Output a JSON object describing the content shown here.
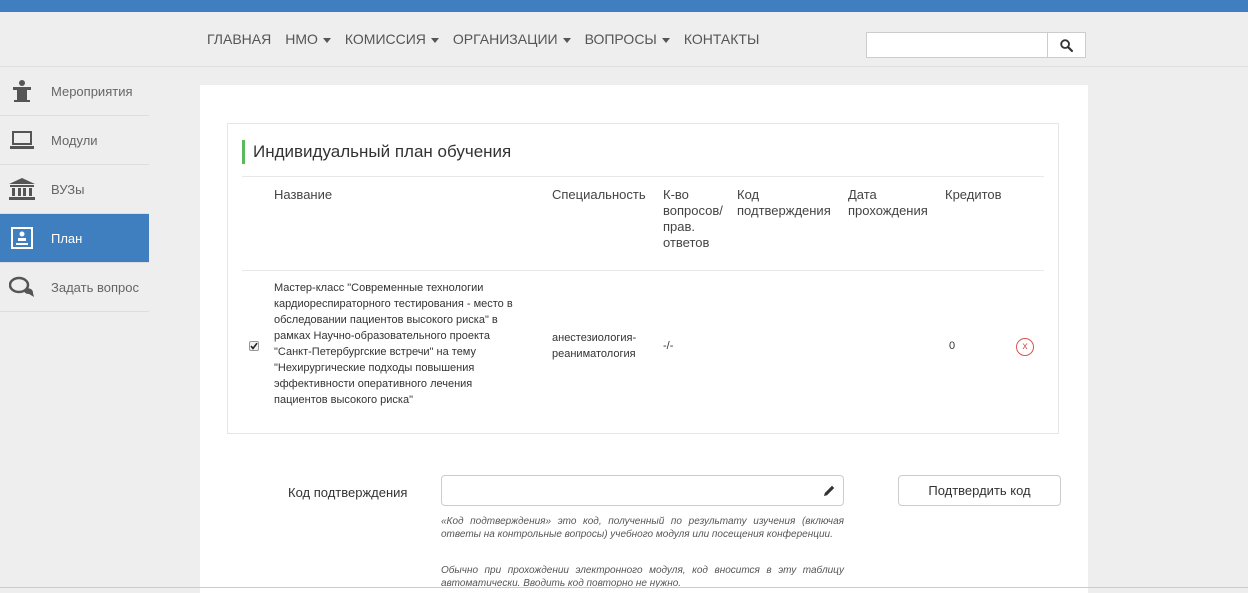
{
  "nav": {
    "items": [
      {
        "label": "ГЛАВНАЯ",
        "dropdown": false
      },
      {
        "label": "НМО",
        "dropdown": true
      },
      {
        "label": "КОМИССИЯ",
        "dropdown": true
      },
      {
        "label": "ОРГАНИЗАЦИИ",
        "dropdown": true
      },
      {
        "label": "ВОПРОСЫ",
        "dropdown": true
      },
      {
        "label": "КОНТАКТЫ",
        "dropdown": false
      }
    ],
    "search": {
      "value": "",
      "icon": "search-icon"
    }
  },
  "sidebar": {
    "items": [
      {
        "label": "Мероприятия",
        "icon": "lectern-icon",
        "active": false
      },
      {
        "label": "Модули",
        "icon": "laptop-icon",
        "active": false
      },
      {
        "label": "ВУЗы",
        "icon": "university-icon",
        "active": false
      },
      {
        "label": "План",
        "icon": "plan-icon",
        "active": true
      },
      {
        "label": "Задать вопрос",
        "icon": "chat-icon",
        "active": false
      }
    ]
  },
  "plan": {
    "title": "Индивидуальный план обучения",
    "headers": {
      "name": "Название",
      "specialty": "Специальность",
      "count": [
        "К-во",
        "вопросов/",
        "прав.",
        "ответов"
      ],
      "code": [
        "Код",
        "подтверждения"
      ],
      "date": [
        "Дата",
        "прохождения"
      ],
      "credits": "Кредитов"
    },
    "row": {
      "checked": true,
      "name_lines": [
        "Мастер-класс \"Современные технологии",
        "кардиореспираторного тестирования - место в",
        "обследовании пациентов высокого риска\" в",
        "рамках Научно-образовательного проекта",
        "\"Санкт-Петербургские встречи\" на тему",
        "\"Нехирургические подходы повышения",
        "эффективности оперативного лечения",
        "пациентов высокого риска\""
      ],
      "specialty_lines": [
        "анестезиология-",
        "реаниматология"
      ],
      "count": "-/-",
      "code": "",
      "date": "",
      "credits": "0",
      "delete_label": "x"
    }
  },
  "confirm": {
    "label": "Код подтверждения",
    "input_value": "",
    "button_label": "Подтвердить код",
    "help_1": "«Код подтверждения» это код, полученный по результату изучения (включая ответы на контрольные вопросы) учебного модуля или посещения конференции.",
    "help_2": "Обычно при прохождении электронного модуля, код вносится в эту таблицу автоматически. Вводить код повторно не нужно."
  },
  "colors": {
    "topbar": "#3f7fbf",
    "active_sidebar": "#3f7fbf",
    "title_accent": "#5cb85c",
    "delete": "#d9534f"
  }
}
